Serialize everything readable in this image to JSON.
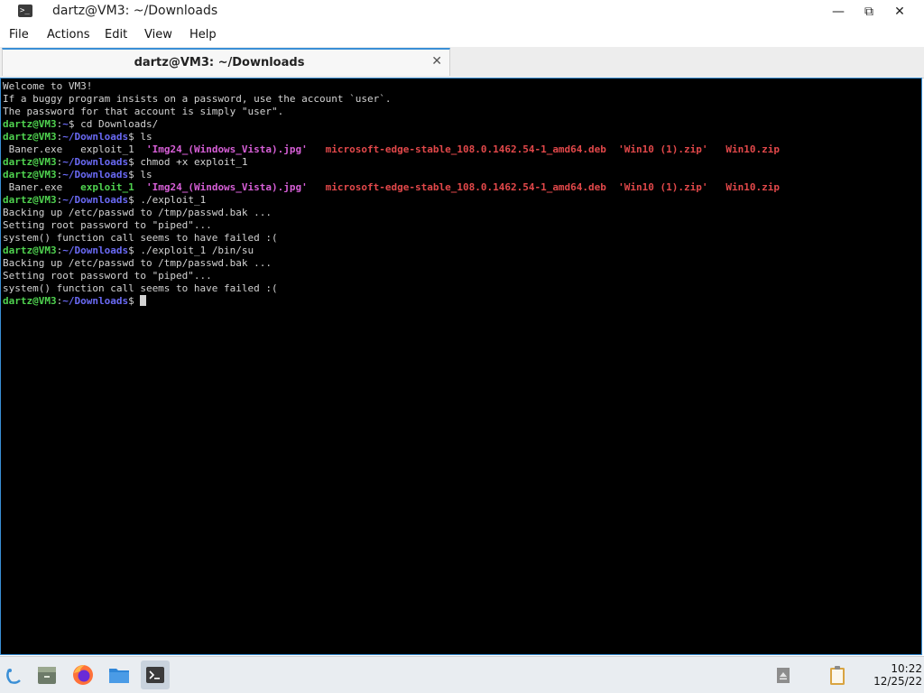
{
  "window": {
    "title": "dartz@VM3: ~/Downloads",
    "controls": {
      "minimize": "—",
      "maximize": "⧉",
      "close": "✕"
    }
  },
  "menu": {
    "items": [
      "File",
      "Actions",
      "Edit",
      "View",
      "Help"
    ]
  },
  "tab": {
    "label": "dartz@VM3: ~/Downloads",
    "close": "✕"
  },
  "terminal": {
    "intro": [
      "Welcome to VM3!",
      "If a buggy program insists on a password, use the account `user`.",
      "The password for that account is simply \"user\"."
    ],
    "prompt_user": "dartz@VM3",
    "prompt_sep": ":",
    "prompt_home": "~",
    "prompt_downloads": "~/Downloads",
    "prompt_dollar": "$ ",
    "cmd1": "cd Downloads/",
    "cmd2": "ls",
    "cmd3": "chmod +x exploit_1",
    "cmd4": "ls",
    "cmd5": "./exploit_1",
    "cmd6": "./exploit_1 /bin/su",
    "files": {
      "baner": "Baner.exe",
      "exploit": "exploit_1",
      "img": "'Img24_(Windows_Vista).jpg'",
      "deb": "microsoft-edge-stable_108.0.1462.54-1_amd64.deb",
      "zip1": "'Win10 (1).zip'",
      "zip2": "Win10.zip"
    },
    "out_backup": "Backing up /etc/passwd to /tmp/passwd.bak ...",
    "out_setting": "Setting root password to \"piped\"...",
    "out_failed": "system() function call seems to have failed :("
  },
  "taskbar": {
    "time": "10:22",
    "date": "12/25/22",
    "icons": [
      "start-menu-icon",
      "file-cabinet-icon",
      "firefox-icon",
      "folder-icon",
      "terminal-icon",
      "eject-icon",
      "clipboard-icon"
    ]
  },
  "colors": {
    "prompt_user": "#4fd24f",
    "prompt_path": "#6a6af5",
    "image_file": "#d75fd7",
    "archive_file": "#e2484a",
    "executable_file": "#4fd24f",
    "accent": "#3a8fd6"
  }
}
